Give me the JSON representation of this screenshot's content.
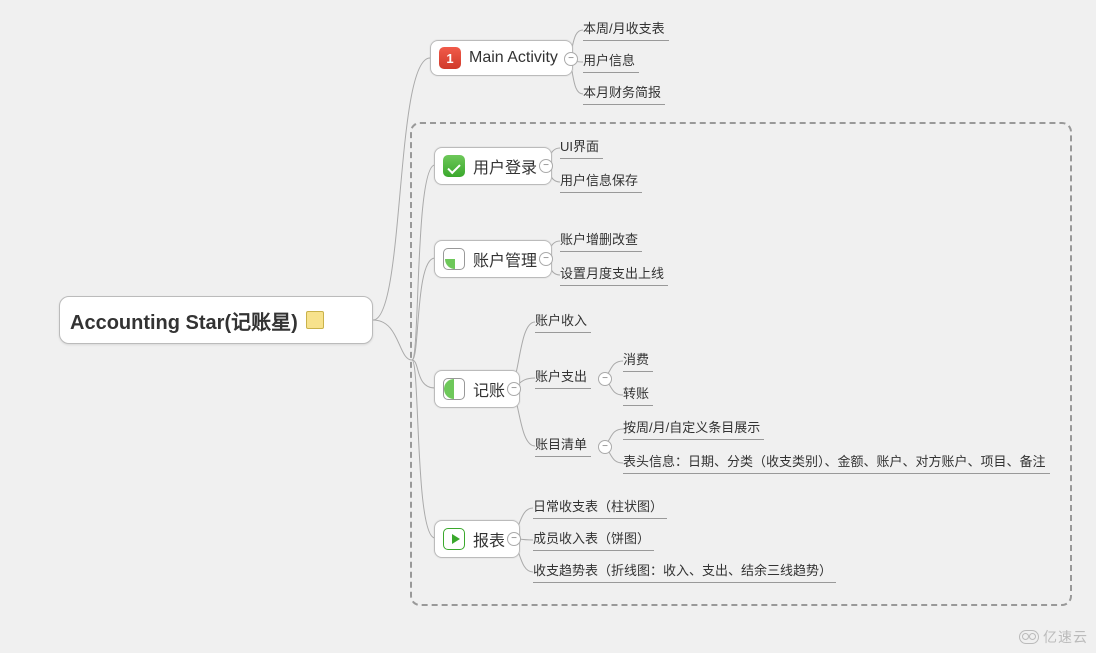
{
  "root": {
    "label": "Accounting Star(记账星)"
  },
  "branches": {
    "mainActivity": {
      "label": "Main Activity",
      "iconText": "1",
      "children": [
        "本周/月收支表",
        "用户信息",
        "本月财务简报"
      ]
    },
    "userLogin": {
      "label": "用户登录",
      "children": [
        "UI界面",
        "用户信息保存"
      ]
    },
    "accountMgmt": {
      "label": "账户管理",
      "children": [
        "账户增删改查",
        "设置月度支出上线"
      ]
    },
    "bookkeeping": {
      "label": "记账",
      "income": "账户收入",
      "expense": {
        "label": "账户支出",
        "children": [
          "消费",
          "转账"
        ]
      },
      "ledger": {
        "label": "账目清单",
        "children": [
          "按周/月/自定义条目展示",
          "表头信息：日期、分类（收支类别）、金额、账户、对方账户、项目、备注"
        ]
      }
    },
    "report": {
      "label": "报表",
      "children": [
        "日常收支表（柱状图）",
        "成员收入表（饼图）",
        "收支趋势表（折线图：收入、支出、结余三线趋势）"
      ]
    }
  },
  "watermark": "亿速云"
}
